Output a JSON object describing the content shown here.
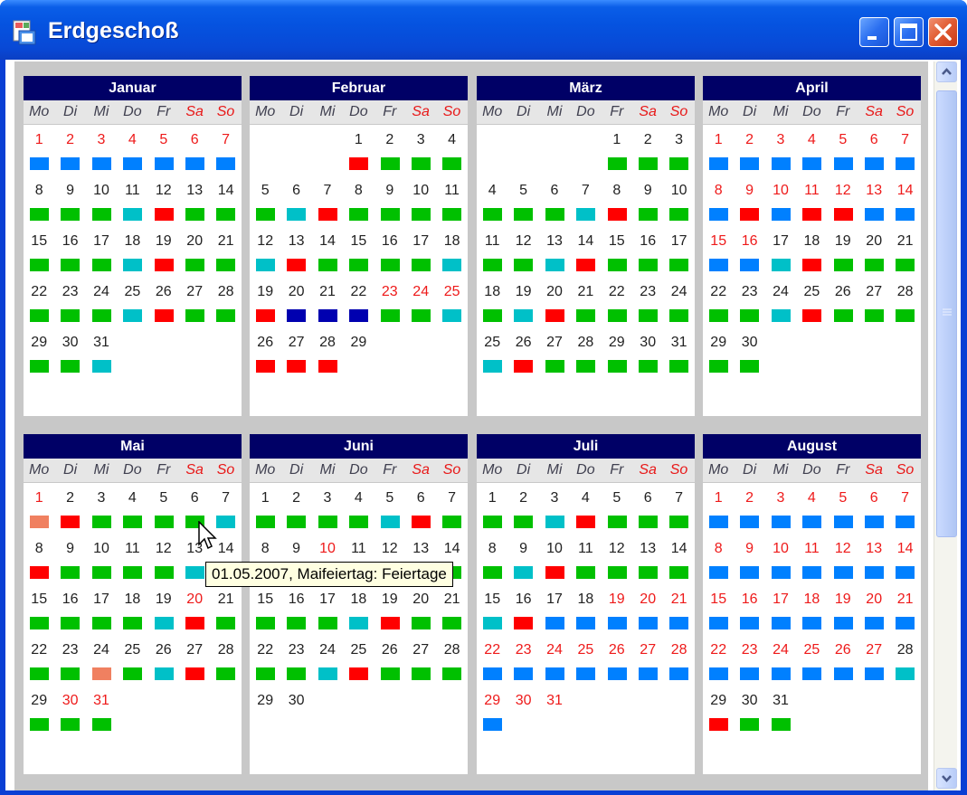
{
  "window": {
    "title": "Erdgeschoß"
  },
  "weekdays": [
    "Mo",
    "Di",
    "Mi",
    "Do",
    "Fr",
    "Sa",
    "So"
  ],
  "colors": {
    "green": "#00c000",
    "teal": "#00c0c8",
    "red": "#ff0000",
    "blue": "#0080ff",
    "navy": "#0000b0",
    "salmon": "#f08060"
  },
  "months": [
    {
      "name": "Januar",
      "start": 0,
      "days": 31,
      "holidayNums": [
        1,
        2,
        3,
        4,
        5,
        6,
        7
      ],
      "bars": "bbbbbbbgggtrgggggtrgggggtrggggt"
    },
    {
      "name": "Februar",
      "start": 3,
      "days": 29,
      "holidayNums": [
        23,
        24,
        25
      ],
      "bars": "rggggtrggggtrggggtrnnnggtrrr"
    },
    {
      "name": "März",
      "start": 4,
      "days": 31,
      "holidayNums": [],
      "bars": "ggggggtrggggtrggggtrggggtrggggggg"
    },
    {
      "name": "April",
      "start": 0,
      "days": 30,
      "holidayNums": [
        1,
        2,
        3,
        4,
        5,
        6,
        7,
        8,
        9,
        10,
        11,
        12,
        13,
        14,
        15,
        16
      ],
      "bars": "bbbbbbbbrbrrbbbbtrgggggtrggggg"
    },
    {
      "name": "Mai",
      "start": 0,
      "days": 31,
      "holidayNums": [
        1,
        20,
        30,
        31
      ],
      "bars": "srggggtrggggtrggggtrgggsgtrggggtrs"
    },
    {
      "name": "Juni",
      "start": 0,
      "days": 30,
      "holidayNums": [
        10
      ],
      "bars": "ggggtrgggggtrggggtrggggtrggg"
    },
    {
      "name": "Juli",
      "start": 0,
      "days": 31,
      "holidayNums": [
        19,
        20,
        21,
        22,
        23,
        24,
        25,
        26,
        27,
        28,
        29,
        30,
        31
      ],
      "bars": "ggtrggggtrggggtrbbbbbbbbbbbbb"
    },
    {
      "name": "August",
      "start": 0,
      "days": 31,
      "holidayNums": [
        1,
        2,
        3,
        4,
        5,
        6,
        7,
        8,
        9,
        10,
        11,
        12,
        13,
        14,
        15,
        16,
        17,
        18,
        19,
        20,
        21,
        22,
        23,
        24,
        25,
        26,
        27
      ],
      "bars": "bbbbbbbbbbbbbbbbbbbbbbbbbbbtrgg"
    }
  ],
  "tooltip": "01.05.2007, Maifeiertag: Feiertage"
}
